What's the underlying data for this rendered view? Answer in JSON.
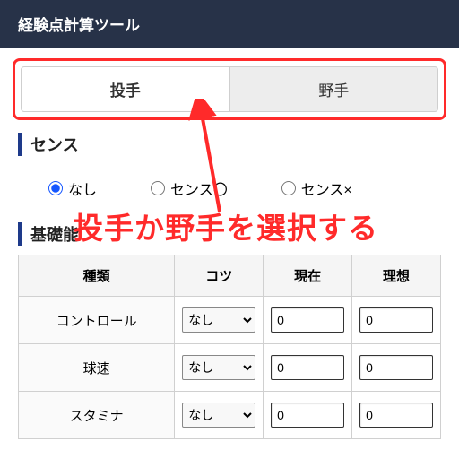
{
  "header": {
    "title": "経験点計算ツール"
  },
  "tabs": {
    "pitcher": "投手",
    "fielder": "野手"
  },
  "sense": {
    "title": "センス",
    "options": {
      "none": "なし",
      "circle": "センス〇",
      "cross": "センス×"
    },
    "selected": "none"
  },
  "stats": {
    "title_prefix": "基礎能",
    "columns": {
      "type": "種類",
      "kotsu": "コツ",
      "now": "現在",
      "ideal": "理想"
    },
    "kotsu_option": "なし",
    "rows": [
      {
        "name": "コントロール",
        "kotsu": "なし",
        "now": "0",
        "ideal": "0"
      },
      {
        "name": "球速",
        "kotsu": "なし",
        "now": "0",
        "ideal": "0"
      },
      {
        "name": "スタミナ",
        "kotsu": "なし",
        "now": "0",
        "ideal": "0"
      }
    ]
  },
  "annotation": "投手か野手を選択する"
}
